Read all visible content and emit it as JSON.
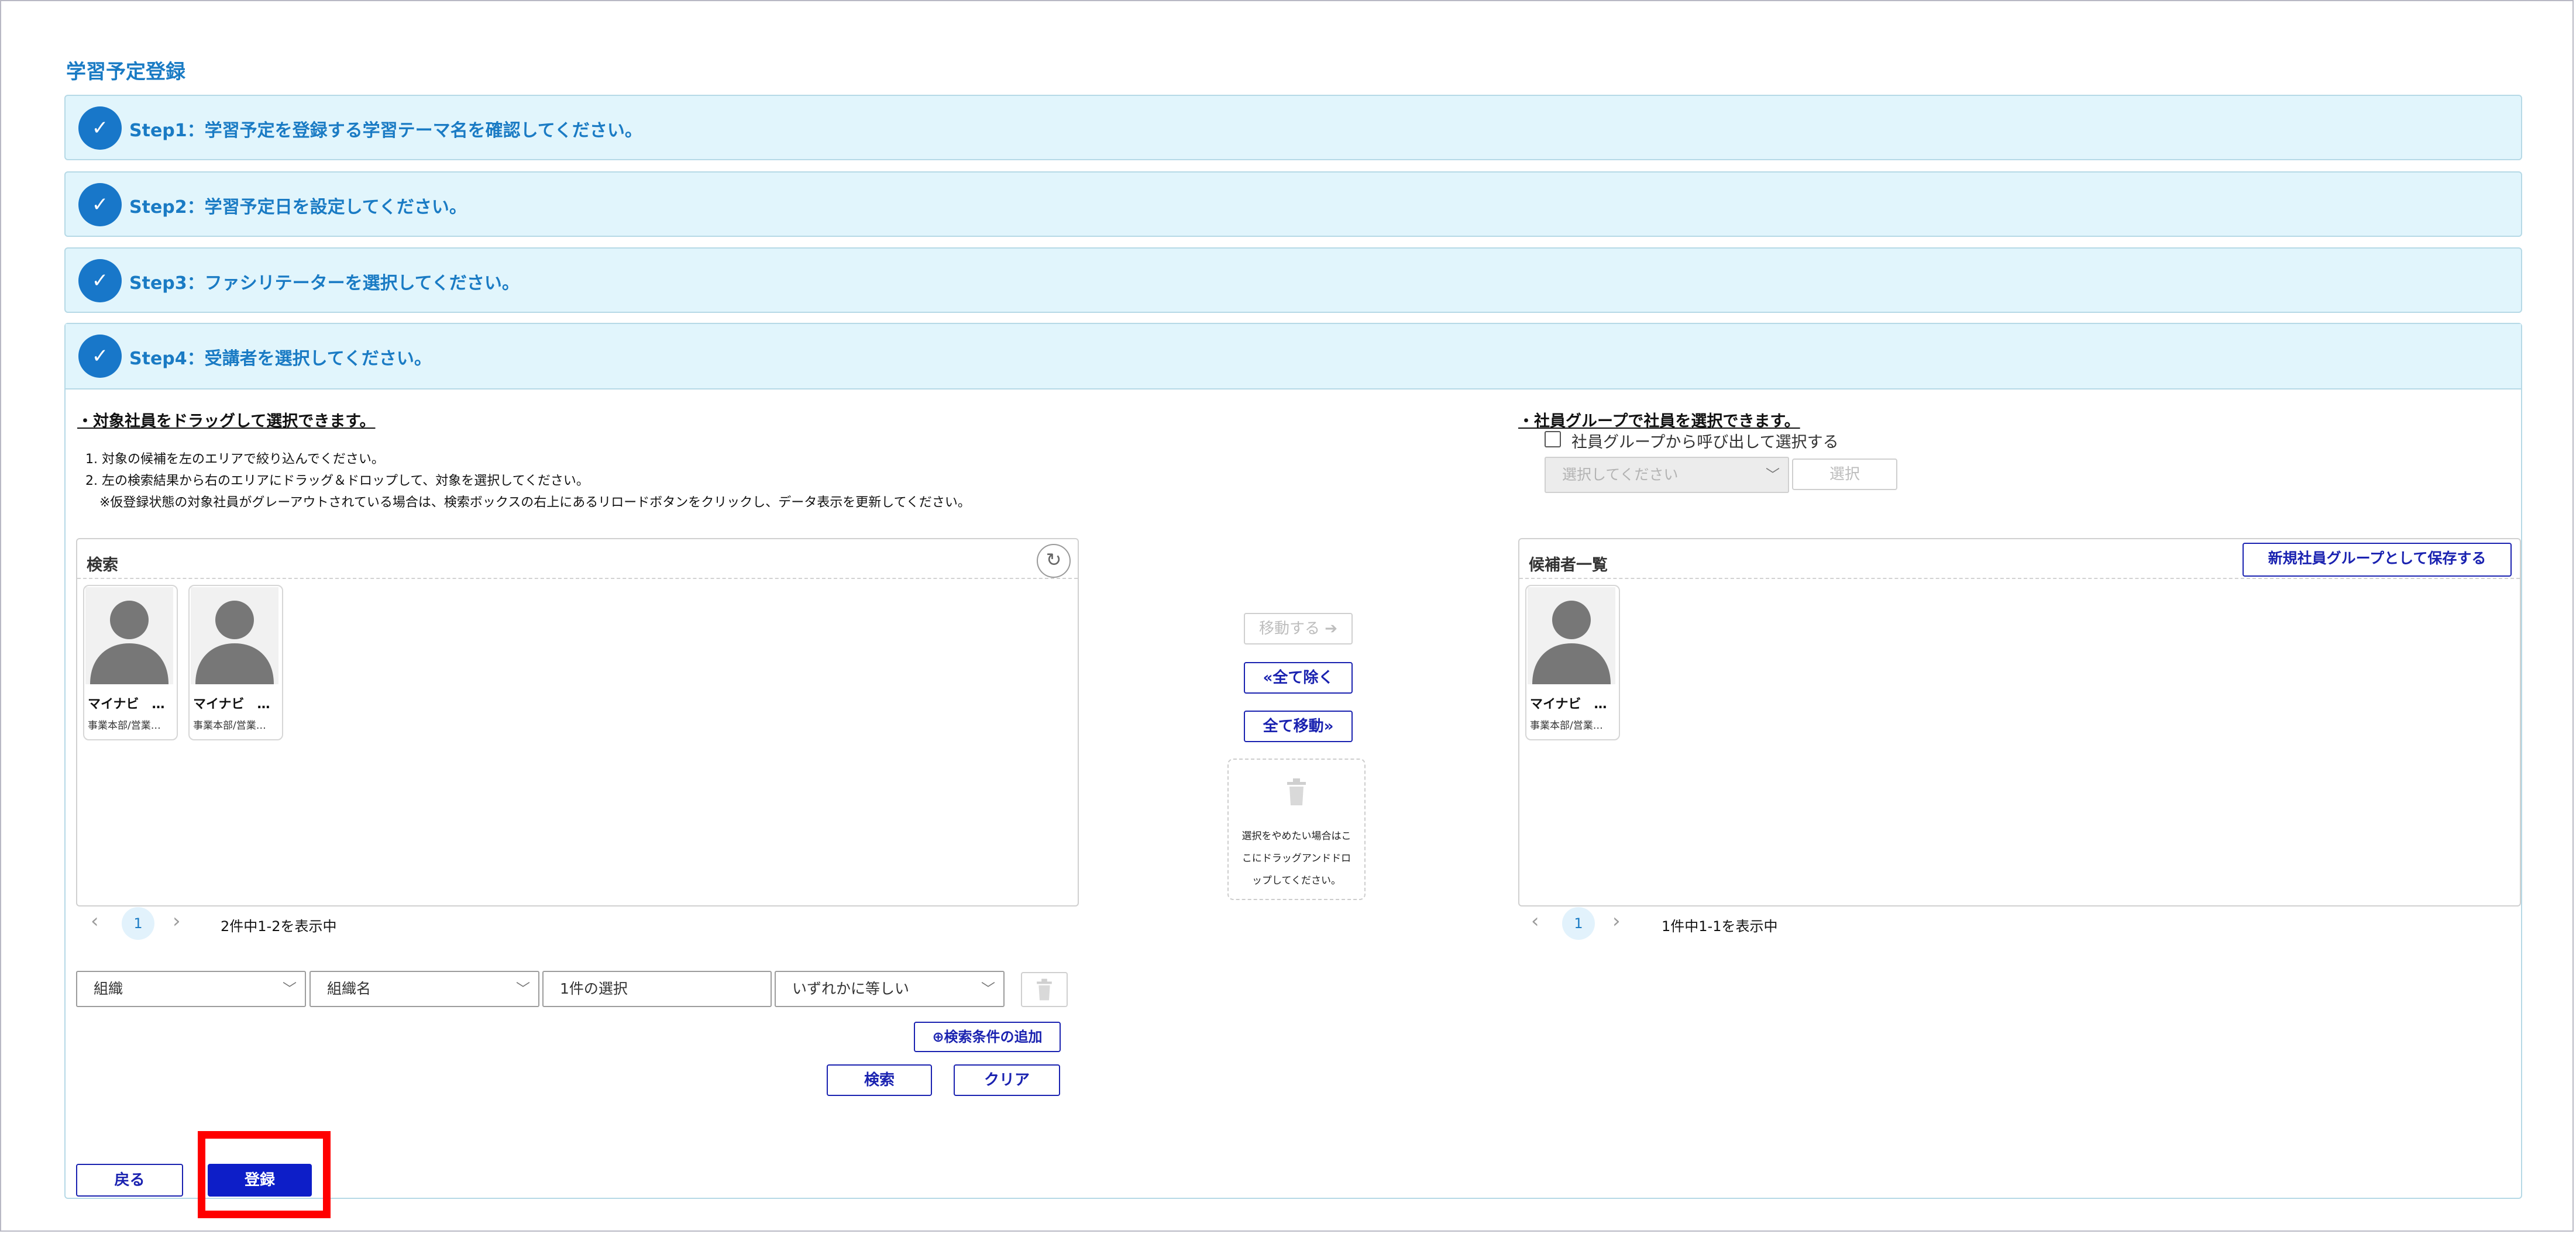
{
  "page": {
    "title": "学習予定登録"
  },
  "steps": [
    {
      "label": "Step1：学習予定を登録する学習テーマ名を確認してください。"
    },
    {
      "label": "Step2：学習予定日を設定してください。"
    },
    {
      "label": "Step3：ファシリテーターを選択してください。"
    },
    {
      "label": "Step4：受講者を選択してください。"
    }
  ],
  "left_section": {
    "heading": "・対象社員をドラッグして選択できます。",
    "instructions": [
      "1. 対象の候補を左のエリアで絞り込んでください。",
      "2. 左の検索結果から右のエリアにドラッグ＆ドロップして、対象を選択してください。",
      "※仮登録状態の対象社員がグレーアウトされている場合は、検索ボックスの右上にあるリロードボタンをクリックし、データ表示を更新してください。"
    ]
  },
  "right_section": {
    "heading": "・社員グループで社員を選択できます。",
    "checkbox_label": "社員グループから呼び出して選択する",
    "group_select_placeholder": "選択してください",
    "select_button": "選択"
  },
  "search_panel": {
    "title": "検索",
    "cards": [
      {
        "name": "マイナビ　…",
        "dept": "事業本部/営業…"
      },
      {
        "name": "マイナビ　…",
        "dept": "事業本部/営業…"
      }
    ],
    "pager": {
      "current": "1",
      "summary": "2件中1-2を表示中"
    }
  },
  "middle": {
    "move_button": "移動する",
    "remove_all_button": "全て除く",
    "move_all_button": "全て移動",
    "trash_text": [
      "選択をやめたい場合はこ",
      "こにドラッグアンドドロ",
      "ップしてください。"
    ]
  },
  "candidates_panel": {
    "title": "候補者一覧",
    "save_group_button": "新規社員グループとして保存する",
    "cards": [
      {
        "name": "マイナビ　…",
        "dept": "事業本部/営業…"
      }
    ],
    "pager": {
      "current": "1",
      "summary": "1件中1-1を表示中"
    }
  },
  "filters": {
    "field1": "組織",
    "field2": "組織名",
    "value": "1件の選択",
    "operator": "いずれかに等しい",
    "add_condition": "検索条件の追加",
    "search_button": "検索",
    "clear_button": "クリア"
  },
  "footer": {
    "back_button": "戻る",
    "register_button": "登録"
  },
  "colors": {
    "accent": "#1a7bc4",
    "button_blue": "#1a22b0",
    "primary_fill": "#0d1ec8",
    "highlight": "#ff0000",
    "step_bg": "#e1f5fc"
  }
}
